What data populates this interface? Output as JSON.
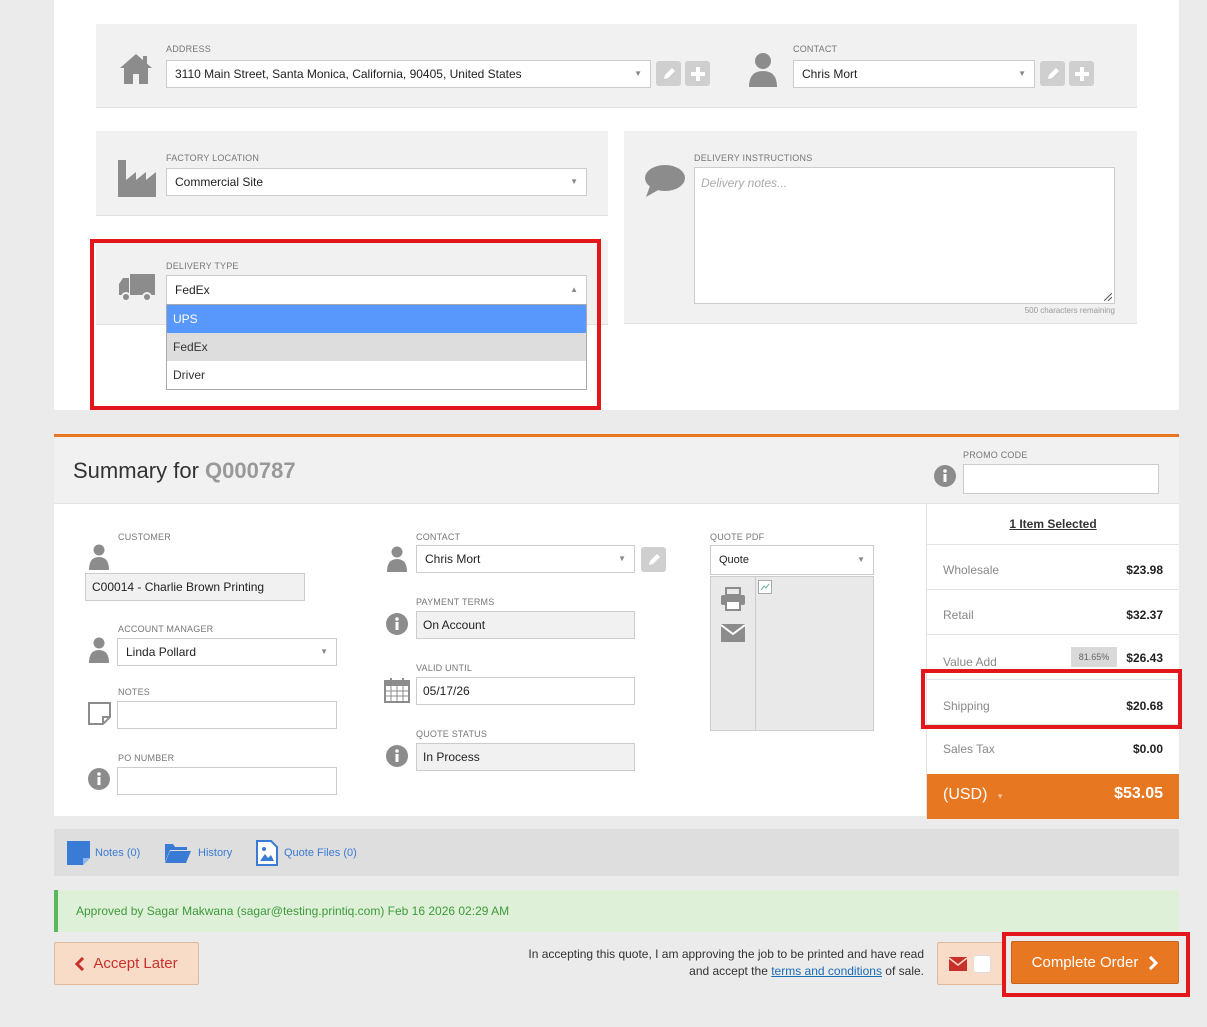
{
  "delivery": {
    "address_label": "ADDRESS",
    "address_value": "3110 Main Street, Santa Monica, California, 90405, United States",
    "contact_label": "CONTACT",
    "contact_value": "Chris Mort",
    "factory_label": "FACTORY LOCATION",
    "factory_value": "Commercial Site",
    "instructions_label": "DELIVERY INSTRUCTIONS",
    "instructions_placeholder": "Delivery notes...",
    "chars_remaining": "500 characters remaining",
    "type_label": "DELIVERY TYPE",
    "type_value": "FedEx",
    "type_options": [
      "UPS",
      "FedEx",
      "Driver"
    ]
  },
  "summary": {
    "title_prefix": "Summary for",
    "quote_number": "Q000787",
    "promo_label": "PROMO CODE",
    "customer_label": "CUSTOMER",
    "customer_value": "C00014 - Charlie Brown Printing",
    "account_manager_label": "ACCOUNT MANAGER",
    "account_manager_value": "Linda Pollard",
    "notes_label": "NOTES",
    "po_label": "PO NUMBER",
    "contact_label": "CONTACT",
    "contact_value": "Chris Mort",
    "payment_terms_label": "PAYMENT TERMS",
    "payment_terms_value": "On Account",
    "valid_until_label": "VALID UNTIL",
    "valid_until_value": "05/17/26",
    "quote_status_label": "QUOTE STATUS",
    "quote_status_value": "In Process",
    "quote_pdf_label": "QUOTE PDF",
    "quote_pdf_value": "Quote"
  },
  "pricing": {
    "items_selected": "1 Item Selected",
    "rows": [
      {
        "label": "Wholesale",
        "value": "$23.98"
      },
      {
        "label": "Retail",
        "value": "$32.37"
      },
      {
        "label": "Value Add",
        "value": "$26.43",
        "badge": "81.65%"
      },
      {
        "label": "Shipping",
        "value": "$20.68"
      },
      {
        "label": "Sales Tax",
        "value": "$0.00"
      }
    ],
    "currency": "(USD)",
    "total": "$53.05",
    "accent_color": "#e87722"
  },
  "tabs": {
    "notes": "Notes",
    "notes_count": "(0)",
    "history": "History",
    "files": "Quote Files",
    "files_count": "(0)"
  },
  "approval_text": "Approved by Sagar Makwana (sagar@testing.printiq.com) Feb 16 2026 02:29 AM",
  "footer": {
    "accept_later": "Accept Later",
    "complete_order": "Complete Order",
    "terms_pre": "In accepting this quote, I am approving the job to be printed and have read and accept the",
    "terms_link": "terms and conditions",
    "terms_post": "of sale."
  }
}
